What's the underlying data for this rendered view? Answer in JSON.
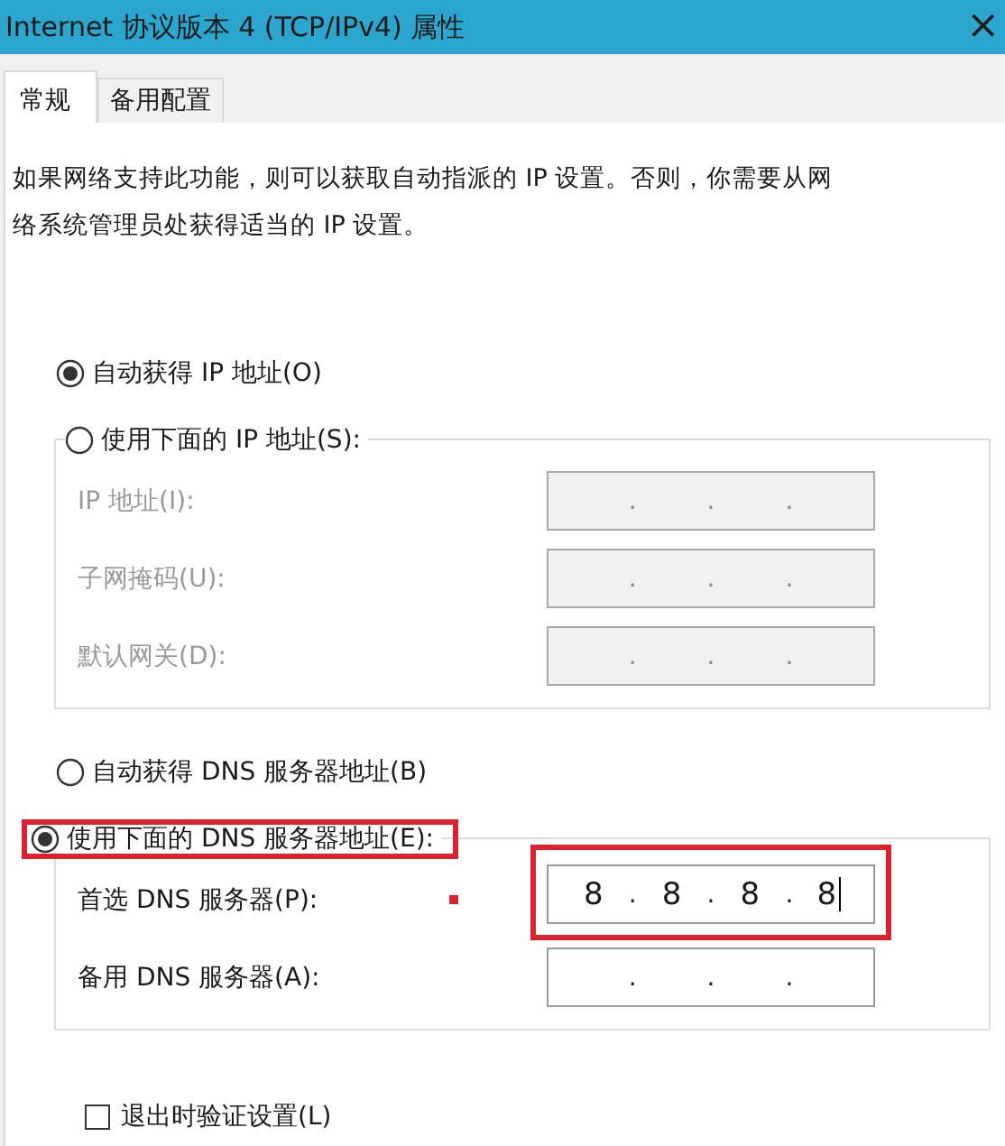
{
  "window": {
    "title": "Internet 协议版本 4 (TCP/IPv4) 属性",
    "close": "×"
  },
  "tabs": [
    {
      "label": "常规",
      "selected": true
    },
    {
      "label": "备用配置",
      "selected": false
    }
  ],
  "description": "如果网络支持此功能，则可以获取自动指派的 IP 设置。否则，你需要从网络系统管理员处获得适当的 IP 设置。",
  "ip_section": {
    "auto_option": {
      "label": "自动获得 IP 地址(O)",
      "selected": true,
      "highlighted": false
    },
    "manual_option": {
      "label": "使用下面的 IP 地址(S):",
      "selected": false,
      "highlighted": false
    },
    "disabled": true,
    "fields": [
      {
        "label": "IP 地址(I):",
        "dots": [
          ".",
          ".",
          "."
        ],
        "focused": false,
        "highlighted": false,
        "marked": false
      },
      {
        "label": "子网掩码(U):",
        "dots": [
          ".",
          ".",
          "."
        ],
        "focused": false,
        "highlighted": false,
        "marked": false
      },
      {
        "label": "默认网关(D):",
        "dots": [
          ".",
          ".",
          "."
        ],
        "focused": false,
        "highlighted": false,
        "marked": false
      }
    ]
  },
  "dns_section": {
    "auto_option": {
      "label": "自动获得 DNS 服务器地址(B)",
      "selected": false,
      "highlighted": false
    },
    "manual_option": {
      "label": "使用下面的 DNS 服务器地址(E):",
      "selected": true,
      "highlighted": true
    },
    "disabled": false,
    "fields": [
      {
        "label": "首选 DNS 服务器(P):",
        "octets": [
          "8",
          "8",
          "8",
          "8"
        ],
        "dots": [
          ".",
          ".",
          "."
        ],
        "focused": true,
        "highlighted": true,
        "marked": true
      },
      {
        "label": "备用 DNS 服务器(A):",
        "dots": [
          ".",
          ".",
          "."
        ],
        "focused": false,
        "highlighted": false,
        "marked": false
      }
    ]
  },
  "validate_on_exit": {
    "label": "退出时验证设置(L)",
    "checked": false
  }
}
